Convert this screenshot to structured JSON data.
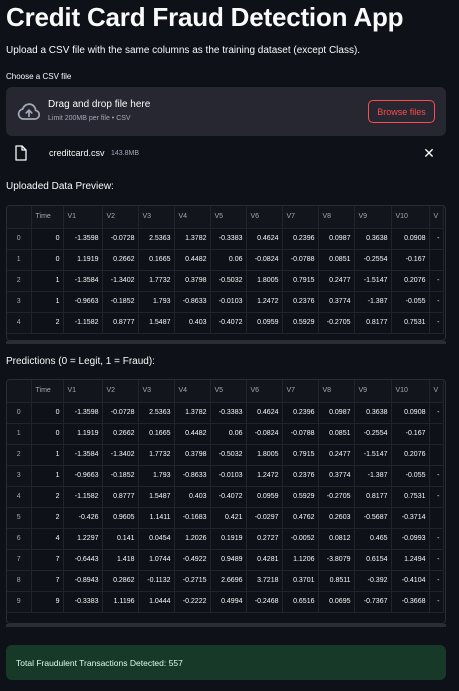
{
  "app": {
    "title": "Credit Card Fraud Detection App",
    "subtitle": "Upload a CSV file with the same columns as the training dataset (except Class)."
  },
  "uploader": {
    "label": "Choose a CSV file",
    "drop_title": "Drag and drop file here",
    "drop_hint": "Limit 200MB per file • CSV",
    "browse_label": "Browse files",
    "file_name": "creditcard.csv",
    "file_size": "143.8MB",
    "close_glyph": "✕"
  },
  "preview": {
    "title": "Uploaded Data Preview:",
    "columns": [
      "",
      "Time",
      "V1",
      "V2",
      "V3",
      "V4",
      "V5",
      "V6",
      "V7",
      "V8",
      "V9",
      "V10",
      "V"
    ],
    "rows": [
      [
        "0",
        "0",
        "-1.3598",
        "-0.0728",
        "2.5363",
        "1.3782",
        "-0.3383",
        "0.4624",
        "0.2396",
        "0.0987",
        "0.3638",
        "0.0908",
        "-"
      ],
      [
        "1",
        "0",
        "1.1919",
        "0.2662",
        "0.1665",
        "0.4482",
        "0.06",
        "-0.0824",
        "-0.0788",
        "0.0851",
        "-0.2554",
        "-0.167",
        ""
      ],
      [
        "2",
        "1",
        "-1.3584",
        "-1.3402",
        "1.7732",
        "0.3798",
        "-0.5032",
        "1.8005",
        "0.7915",
        "0.2477",
        "-1.5147",
        "0.2076",
        "-"
      ],
      [
        "3",
        "1",
        "-0.9663",
        "-0.1852",
        "1.793",
        "-0.8633",
        "-0.0103",
        "1.2472",
        "0.2376",
        "0.3774",
        "-1.387",
        "-0.055",
        "-"
      ],
      [
        "4",
        "2",
        "-1.1582",
        "0.8777",
        "1.5487",
        "0.403",
        "-0.4072",
        "0.0959",
        "0.5929",
        "-0.2705",
        "0.8177",
        "0.7531",
        "-"
      ]
    ]
  },
  "predictions": {
    "title": "Predictions (0 = Legit, 1 = Fraud):",
    "columns": [
      "",
      "Time",
      "V1",
      "V2",
      "V3",
      "V4",
      "V5",
      "V6",
      "V7",
      "V8",
      "V9",
      "V10",
      "V"
    ],
    "rows": [
      [
        "0",
        "0",
        "-1.3598",
        "-0.0728",
        "2.5363",
        "1.3782",
        "-0.3383",
        "0.4624",
        "0.2396",
        "0.0987",
        "0.3638",
        "0.0908",
        "-"
      ],
      [
        "1",
        "0",
        "1.1919",
        "0.2662",
        "0.1665",
        "0.4482",
        "0.06",
        "-0.0824",
        "-0.0788",
        "0.0851",
        "-0.2554",
        "-0.167",
        ""
      ],
      [
        "2",
        "1",
        "-1.3584",
        "-1.3402",
        "1.7732",
        "0.3798",
        "-0.5032",
        "1.8005",
        "0.7915",
        "0.2477",
        "-1.5147",
        "0.2076",
        ""
      ],
      [
        "3",
        "1",
        "-0.9663",
        "-0.1852",
        "1.793",
        "-0.8633",
        "-0.0103",
        "1.2472",
        "0.2376",
        "0.3774",
        "-1.387",
        "-0.055",
        "-"
      ],
      [
        "4",
        "2",
        "-1.1582",
        "0.8777",
        "1.5487",
        "0.403",
        "-0.4072",
        "0.0959",
        "0.5929",
        "-0.2705",
        "0.8177",
        "0.7531",
        "-"
      ],
      [
        "5",
        "2",
        "-0.426",
        "0.9605",
        "1.1411",
        "-0.1683",
        "0.421",
        "-0.0297",
        "0.4762",
        "0.2603",
        "-0.5687",
        "-0.3714",
        ""
      ],
      [
        "6",
        "4",
        "1.2297",
        "0.141",
        "0.0454",
        "1.2026",
        "0.1919",
        "0.2727",
        "-0.0052",
        "0.0812",
        "0.465",
        "-0.0993",
        "-"
      ],
      [
        "7",
        "7",
        "-0.6443",
        "1.418",
        "1.0744",
        "-0.4922",
        "0.9489",
        "0.4281",
        "1.1206",
        "-3.8079",
        "0.6154",
        "1.2494",
        "-"
      ],
      [
        "8",
        "7",
        "-0.8943",
        "0.2862",
        "-0.1132",
        "-0.2715",
        "2.6696",
        "3.7218",
        "0.3701",
        "0.8511",
        "-0.392",
        "-0.4104",
        "-"
      ],
      [
        "9",
        "9",
        "-0.3383",
        "1.1196",
        "1.0444",
        "-0.2222",
        "0.4994",
        "-0.2468",
        "0.6516",
        "0.0695",
        "-0.7367",
        "-0.3668",
        "-"
      ]
    ]
  },
  "result": {
    "message": "Total Fraudulent Transactions Detected: 557"
  },
  "colors": {
    "background": "#0e1117",
    "accent": "#ff4b4b",
    "success_bg": "#173928",
    "dropzone_bg": "#262730"
  },
  "icons": {
    "upload": "cloud-upload-icon",
    "file": "file-icon",
    "close": "close-icon"
  }
}
